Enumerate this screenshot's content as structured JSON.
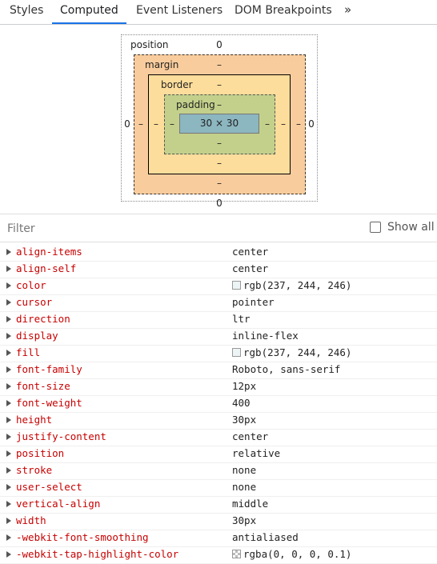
{
  "tabs": [
    {
      "label": "Styles",
      "active": false
    },
    {
      "label": "Computed",
      "active": true
    },
    {
      "label": "Event Listeners",
      "active": false
    },
    {
      "label": "DOM Breakpoints",
      "active": false
    }
  ],
  "more_tabs": "»",
  "box_model": {
    "position_label": "position",
    "position_top": "0",
    "position_bottom": "0",
    "position_left": "0",
    "position_right": "0",
    "margin_label": "margin",
    "margin_top": "–",
    "margin_bottom": "–",
    "margin_left": "–",
    "margin_right": "–",
    "border_label": "border",
    "border_top": "–",
    "border_bottom": "–",
    "border_left": "–",
    "border_right": "–",
    "padding_label": "padding",
    "padding_top": "–",
    "padding_bottom": "–",
    "padding_left": "–",
    "padding_right": "–",
    "content": "30 × 30"
  },
  "filter": {
    "placeholder": "Filter",
    "show_all_label": "Show all",
    "show_all_checked": false
  },
  "properties": [
    {
      "name": "align-items",
      "value": "center"
    },
    {
      "name": "align-self",
      "value": "center"
    },
    {
      "name": "color",
      "value": "rgb(237, 244, 246)",
      "swatch": "#edf4f6"
    },
    {
      "name": "cursor",
      "value": "pointer"
    },
    {
      "name": "direction",
      "value": "ltr"
    },
    {
      "name": "display",
      "value": "inline-flex"
    },
    {
      "name": "fill",
      "value": "rgb(237, 244, 246)",
      "swatch": "#edf4f6"
    },
    {
      "name": "font-family",
      "value": "Roboto, sans-serif"
    },
    {
      "name": "font-size",
      "value": "12px"
    },
    {
      "name": "font-weight",
      "value": "400"
    },
    {
      "name": "height",
      "value": "30px"
    },
    {
      "name": "justify-content",
      "value": "center"
    },
    {
      "name": "position",
      "value": "relative"
    },
    {
      "name": "stroke",
      "value": "none"
    },
    {
      "name": "user-select",
      "value": "none"
    },
    {
      "name": "vertical-align",
      "value": "middle"
    },
    {
      "name": "width",
      "value": "30px"
    },
    {
      "name": "-webkit-font-smoothing",
      "value": "antialiased"
    },
    {
      "name": "-webkit-tap-highlight-color",
      "value": "rgba(0, 0, 0, 0.1)",
      "swatch": "checker"
    }
  ]
}
